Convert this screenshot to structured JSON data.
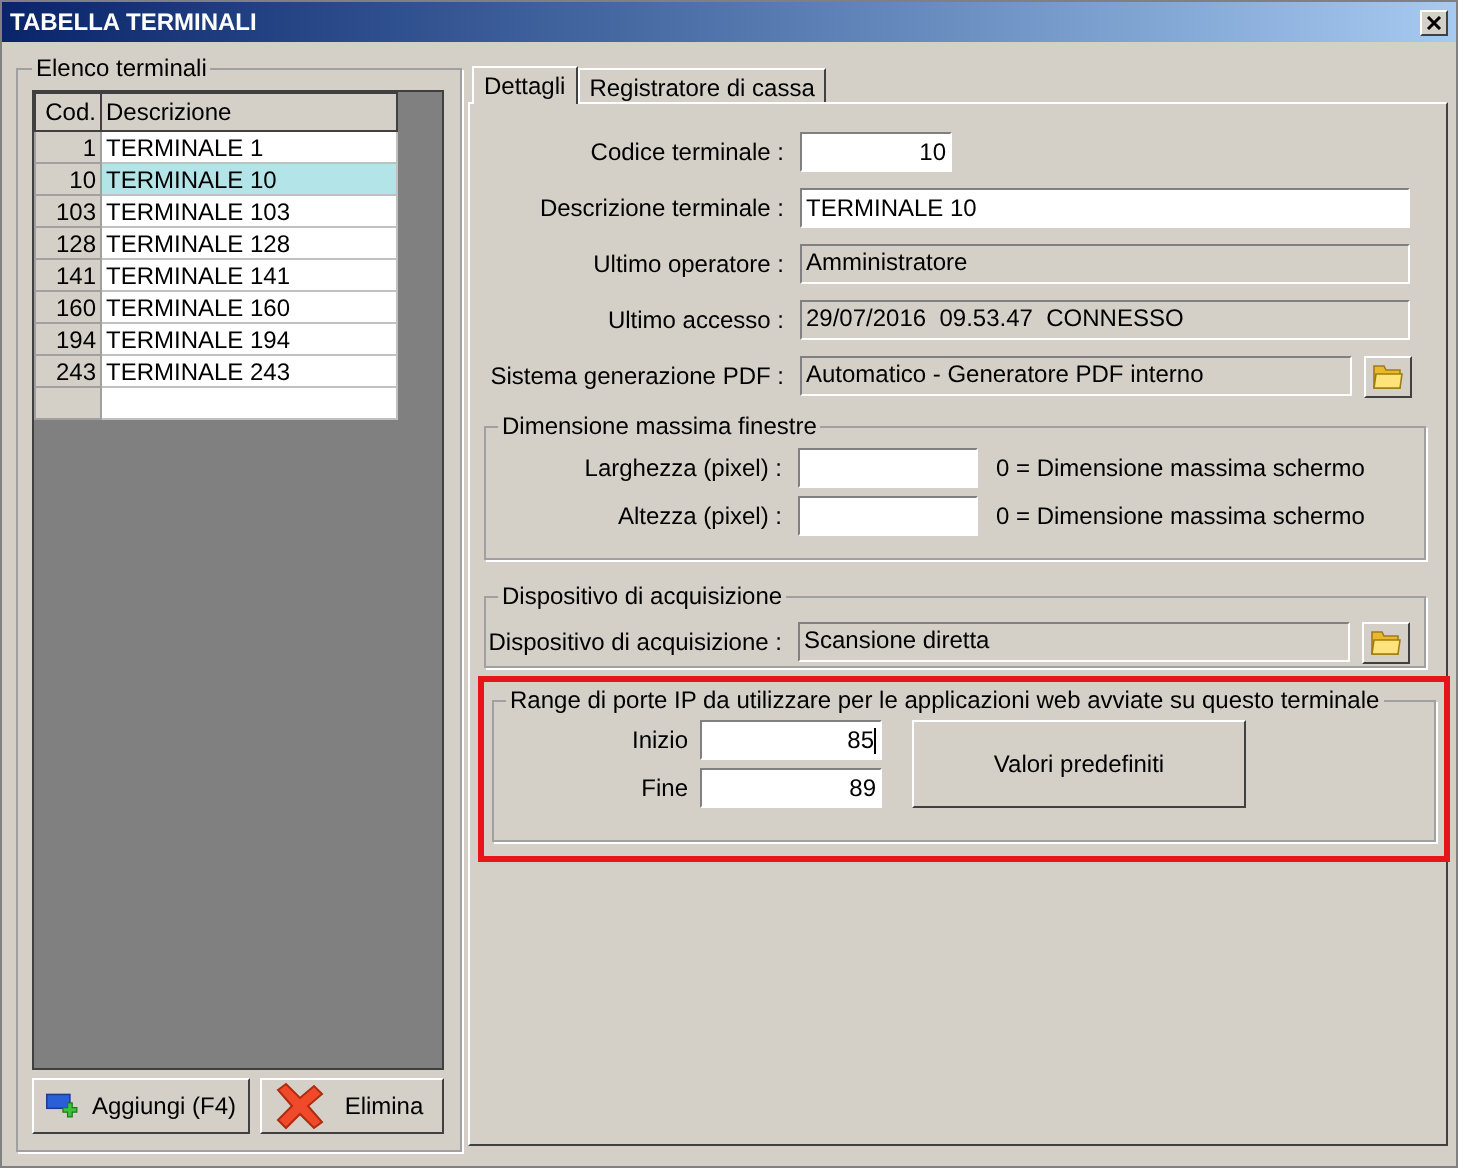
{
  "window": {
    "title": "TABELLA TERMINALI"
  },
  "terminals": {
    "title": "Elenco terminali",
    "columns": [
      "Cod.",
      "Descrizione"
    ],
    "rows": [
      {
        "code": "1",
        "description": "TERMINALE 1",
        "selected": false
      },
      {
        "code": "10",
        "description": "TERMINALE 10",
        "selected": true
      },
      {
        "code": "103",
        "description": "TERMINALE 103",
        "selected": false
      },
      {
        "code": "128",
        "description": "TERMINALE 128",
        "selected": false
      },
      {
        "code": "141",
        "description": "TERMINALE 141",
        "selected": false
      },
      {
        "code": "160",
        "description": "TERMINALE 160",
        "selected": false
      },
      {
        "code": "194",
        "description": "TERMINALE 194",
        "selected": false
      },
      {
        "code": "243",
        "description": "TERMINALE 243",
        "selected": false
      }
    ],
    "buttons": [
      {
        "kind": "add",
        "label": "Aggiungi (F4)"
      },
      {
        "kind": "delete",
        "label": "Elimina"
      }
    ]
  },
  "tabs": [
    {
      "label": "Dettagli",
      "selected": true
    },
    {
      "label": "Registratore di cassa",
      "selected": false
    }
  ],
  "details": [
    {
      "label": "Codice terminale :",
      "value": "10",
      "kind": "number"
    },
    {
      "label": "Descrizione terminale :",
      "value": "TERMINALE 10",
      "kind": "text"
    },
    {
      "label": "Ultimo operatore :",
      "value": "Amministratore",
      "kind": "readonly"
    },
    {
      "label": "Ultimo accesso :",
      "value": "29/07/2016  09.53.47  CONNESSO",
      "kind": "readonly"
    },
    {
      "label": "Sistema generazione PDF :",
      "value": "Automatico - Generatore PDF interno",
      "kind": "picker"
    }
  ],
  "window_size": {
    "title": "Dimensione massima finestre",
    "fields": [
      {
        "label": "Larghezza (pixel) :",
        "hint": "0 = Dimensione massima schermo"
      },
      {
        "label": "Altezza (pixel) :",
        "hint": "0 = Dimensione massima schermo"
      }
    ]
  },
  "acquisition": {
    "title": "Dispositivo di acquisizione",
    "fields": [
      {
        "label": "Dispositivo di acquisizione :",
        "value": "Scansione diretta",
        "kind": "picker"
      }
    ]
  },
  "port_range": {
    "title": "Range di porte IP da utilizzare per le applicazioni web avviate su questo terminale",
    "highlighted": true,
    "fields": [
      {
        "label": "Inizio",
        "value": "85",
        "focused": true
      },
      {
        "label": "Fine",
        "value": "89",
        "focused": false
      }
    ],
    "button": "Valori predefiniti"
  }
}
